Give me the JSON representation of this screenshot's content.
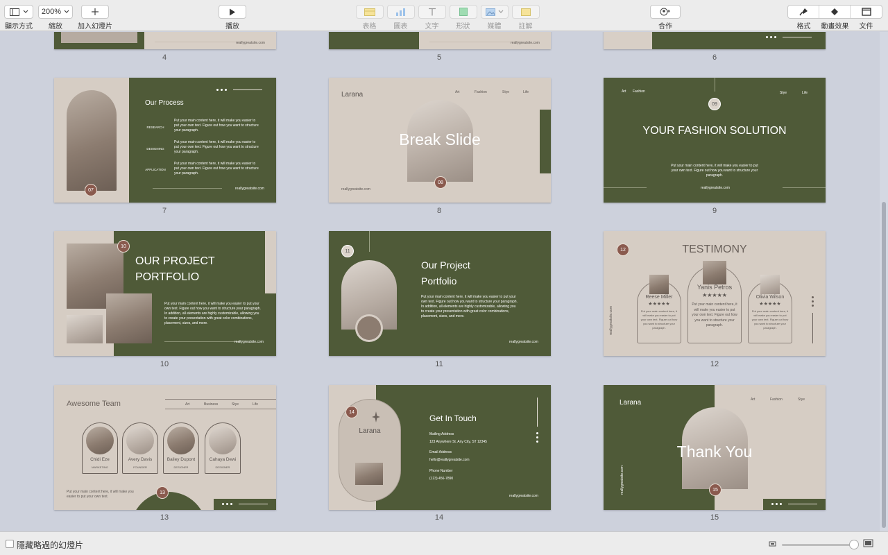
{
  "toolbar": {
    "view_label": "顯示方式",
    "zoom_value": "200%",
    "zoom_label": "縮放",
    "add_slide_label": "加入幻燈片",
    "play_label": "播放",
    "insert_labels": [
      "表格",
      "圖表",
      "文字",
      "形狀",
      "媒體",
      "註解"
    ],
    "collaborate_label": "合作",
    "format_label": "格式",
    "animate_label": "動畫效果",
    "document_label": "文件"
  },
  "slide_numbers": [
    "4",
    "5",
    "6",
    "7",
    "8",
    "9",
    "10",
    "11",
    "12",
    "13",
    "14",
    "15"
  ],
  "slides": {
    "s4": {
      "website": "reallygreatsite.com"
    },
    "s5": {
      "website": "reallygreatsite.com"
    },
    "s7": {
      "title": "Our Process",
      "steps": [
        "RESEARCH",
        "DESIGNING",
        "APPLICATION"
      ],
      "body": "Put your main content here, it will make you easier to put your own text. Figure out how you want to structure your paragraph.",
      "badge": "07",
      "website": "reallygreatsite.com"
    },
    "s8": {
      "brand": "Larana",
      "nav": [
        "Art",
        "Fashion",
        "Stye",
        "Life"
      ],
      "title": "Break Slide",
      "badge": "08",
      "website": "reallygreatsite.com"
    },
    "s9": {
      "nav_left": [
        "Art",
        "Fashion"
      ],
      "nav_right": [
        "Stye",
        "Life"
      ],
      "badge": "09",
      "title": "YOUR FASHION SOLUTION",
      "body": "Put your main content here, it will make you easier to put your own text. Figure out how you want to structure your paragraph.",
      "website": "reallygreatsite.com"
    },
    "s10": {
      "badge": "10",
      "title_line1": "OUR PROJECT",
      "title_line2": "PORTFOLIO",
      "body": "Put your main content here, it will make you easier to put your own text. Figure out how you want to structure your paragraph. In addition, all elements are highly customizable, allowing you to create your presentation with great color combinations, placement, sizes, and more.",
      "website": "reallygreatsite.com"
    },
    "s11": {
      "badge": "11",
      "title_line1": "Our Project",
      "title_line2": "Portfolio",
      "body": "Put your main content here, it will make you easier to put your own text. Figure out how you want to structure your paragraph. In addition, all elements are highly customizable, allowing you to create your presentation with great color combinations, placement, sizes, and more.",
      "website": "reallygreatsite.com"
    },
    "s12": {
      "badge": "12",
      "title": "TESTIMONY",
      "website": "reallygreatsite.com",
      "people": [
        {
          "name": "Reese Miller",
          "stars": "★★★★★",
          "text": "Put your main content here, it will make you easier to put your own text. Figure out how you want to structure your paragraph."
        },
        {
          "name": "Yanis Petros",
          "stars": "★★★★★",
          "text": "Put your main content here, it will make you easier to put your own text. Figure out how you want to structure your paragraph."
        },
        {
          "name": "Olivia Wilson",
          "stars": "★★★★★",
          "text": "Put your main content here, it will make you easier to put your own text. Figure out how you want to structure your paragraph."
        }
      ]
    },
    "s13": {
      "title": "Awesome Team",
      "nav": [
        "Art",
        "Business",
        "Stye",
        "Life"
      ],
      "members": [
        {
          "name": "Chidi Eze",
          "role": "MARKETING"
        },
        {
          "name": "Avery Davis",
          "role": "FOUNDER"
        },
        {
          "name": "Bailey Dupont",
          "role": "DESIGNER"
        },
        {
          "name": "Cahaya Dewi",
          "role": "DESIGNER"
        }
      ],
      "body": "Put your main content here, it will make you easier to put your own text.",
      "badge": "13"
    },
    "s14": {
      "badge": "14",
      "brand": "Larana",
      "title": "Get In Touch",
      "mail_label": "Mailing Address",
      "mail_value": "123 Anywhere St. Any City, ST 12345",
      "email_label": "Email Address",
      "email_value": "hello@reallygreatsite.com",
      "phone_label": "Phone Number",
      "phone_value": "(123) 456-7890",
      "website": "reallygreatsite.com"
    },
    "s15": {
      "brand": "Larana",
      "nav": [
        "Art",
        "Fashion",
        "Stye"
      ],
      "title": "Thank You",
      "badge": "15",
      "website": "reallygreatsite.com"
    }
  },
  "bottombar": {
    "hide_skipped_label": "隱藏略過的幻燈片"
  }
}
